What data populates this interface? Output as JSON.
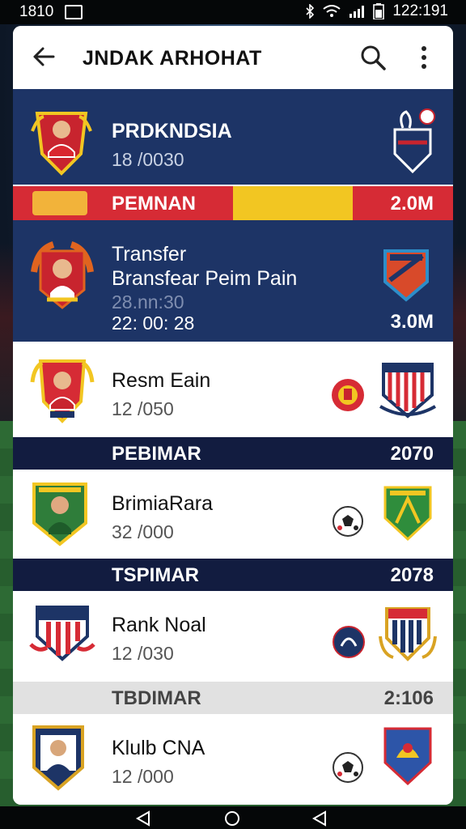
{
  "status_bar": {
    "time": "1810",
    "clock": "122:191"
  },
  "header": {
    "title": "JNDAK ARHOHAT"
  },
  "featured": {
    "name": "PRDKNDSIA",
    "sub": "18 /0030",
    "banner_label": "PEMNAN",
    "banner_value": "2.0M"
  },
  "transfer": {
    "title": "Transfer",
    "subtitle": "Bransfear Peim Pain",
    "time_faded": "28.nn:30",
    "time": "22: 00: 28",
    "value": "3.0M"
  },
  "rows": [
    {
      "name": "Resm Eain",
      "sub": "12 /050"
    },
    {
      "name": "BrimiaRara",
      "sub": "32 /000"
    },
    {
      "name": "Rank Noal",
      "sub": "12 /030"
    },
    {
      "name": "Klulb CNA",
      "sub": "12 /000"
    }
  ],
  "bands": [
    {
      "label": "PEBIMAR",
      "value": "2070"
    },
    {
      "label": "TSPIMAR",
      "value": "2078"
    },
    {
      "label": "TBDIMAR",
      "value": "2:106"
    }
  ],
  "colors": {
    "navy": "#1d3466",
    "band": "#121c40",
    "red": "#d62b35",
    "yellow": "#f2c622"
  }
}
